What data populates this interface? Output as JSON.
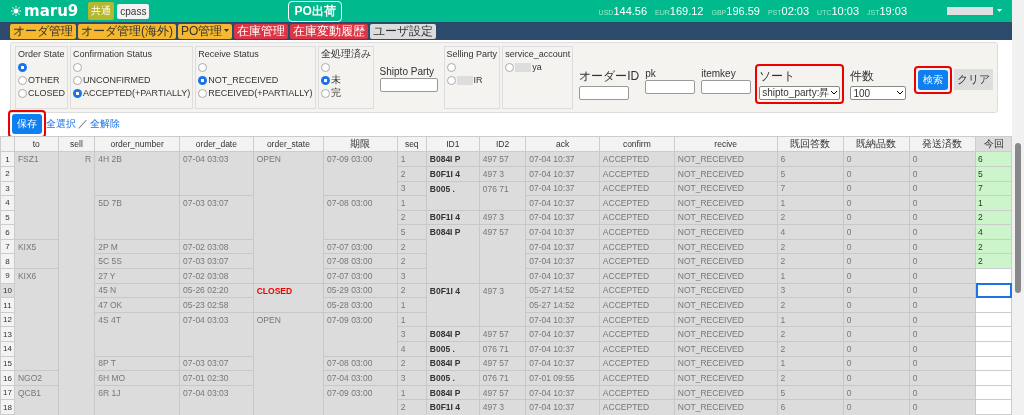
{
  "header": {
    "logo": "maru9",
    "badges": [
      {
        "label": "共通",
        "kind": "olive"
      },
      {
        "label": "cpass",
        "kind": "light"
      }
    ],
    "title": "PO出荷",
    "rates": [
      {
        "label": "USD",
        "value": "144.56"
      },
      {
        "label": "EUR",
        "value": "169.12"
      },
      {
        "label": "GBP",
        "value": "196.59"
      },
      {
        "label": "PST",
        "value": "02:03"
      },
      {
        "label": "UTC",
        "value": "10:03"
      },
      {
        "label": "JST",
        "value": "19:03"
      }
    ]
  },
  "nav": [
    {
      "label": "オーダ管理",
      "color": "#f5b82e",
      "dropdown": false
    },
    {
      "label": "オーダ管理(海外)",
      "color": "#f5b82e",
      "dropdown": false
    },
    {
      "label": "PO管理",
      "color": "#f5b82e",
      "dropdown": true
    },
    {
      "label": "在庫管理",
      "color": "#dc3545",
      "dropdown": false
    },
    {
      "label": "在庫変動履歴",
      "color": "#dc3545",
      "dropdown": false
    },
    {
      "label": "ユーザ設定",
      "color": "#dddddd",
      "dropdown": false
    }
  ],
  "filters": {
    "radio_groups": [
      {
        "title": "Order State",
        "options": [
          {
            "checked": true
          },
          {
            "label": "OTHER",
            "checked": false
          },
          {
            "label": "CLOSED",
            "checked": false
          }
        ]
      },
      {
        "title": "Confirmation Status",
        "options": [
          {
            "checked": false
          },
          {
            "label": "UNCONFIRMED",
            "checked": false
          },
          {
            "label": "ACCEPTED(+PARTIALLY)",
            "checked": true
          }
        ]
      },
      {
        "title": "Receive Status",
        "options": [
          {
            "checked": false
          },
          {
            "label": "NOT_RECEIVED",
            "checked": true
          },
          {
            "label": "RECEIVED(+PARTIALLY)",
            "checked": false
          }
        ]
      },
      {
        "title": "全処理済み",
        "options": [
          {
            "checked": false
          },
          {
            "label": "未",
            "checked": true
          },
          {
            "label": "完",
            "checked": false
          }
        ]
      }
    ],
    "shipto_party": {
      "label": "Shipto Party"
    },
    "selling_party": {
      "title": "Selling Party",
      "options": [
        {
          "checked": false
        },
        {
          "label": "IR",
          "masked": true,
          "checked": false
        }
      ]
    },
    "service_account": {
      "title": "service_account",
      "options": [
        {
          "label": "ya",
          "masked": true,
          "checked": false
        }
      ]
    },
    "text_fields": [
      {
        "label": "オーダーID"
      },
      {
        "label": "pk"
      },
      {
        "label": "itemkey"
      }
    ],
    "selects": [
      {
        "label": "ソート",
        "value": "shipto_party:昇",
        "highlighted": true
      },
      {
        "label": "件数",
        "value": "100",
        "highlighted": false
      }
    ],
    "search_button": {
      "label": "検索",
      "highlighted": true
    },
    "clear_button": {
      "label": "クリア"
    }
  },
  "actions": {
    "save": {
      "label": "保存",
      "highlighted": true
    },
    "select_all": "全選択",
    "separator": "／",
    "deselect_all": "全解除"
  },
  "table": {
    "columns": [
      "to",
      "sell",
      "order_number",
      "order_date",
      "order_state",
      "期限",
      "seq",
      "ID1",
      "ID2",
      "ack",
      "confirm",
      "recive",
      "既回答数",
      "既納品数",
      "発送済数",
      "今回"
    ],
    "rows": [
      {
        "no": "1",
        "selected": false,
        "to": "FSZ1",
        "sell": "R",
        "order_number": "4H 2B",
        "order_date": "07-04 03:03",
        "order_state": "OPEN",
        "emphasized": false,
        "limit": "07-09 03:00",
        "seq": "1",
        "id1": "B084I P",
        "id2": "497 57",
        "ack": "07-04 10:37",
        "confirm": "ACCEPTED",
        "recive": "NOT_RECEIVED",
        "answered": "6",
        "delivered": "0",
        "shipped": "0",
        "current": "6"
      },
      {
        "no": "2",
        "selected": false,
        "seq": "2",
        "id1": "B0F1I 4",
        "id2": "497 3",
        "ack": "07-04 10:37",
        "confirm": "ACCEPTED",
        "recive": "NOT_RECEIVED",
        "answered": "5",
        "delivered": "0",
        "shipped": "0",
        "current": "5"
      },
      {
        "no": "3",
        "selected": false,
        "seq": "3",
        "id1": "B005 .",
        "id2": "076 71",
        "ack": "07-04 10:37",
        "confirm": "ACCEPTED",
        "recive": "NOT_RECEIVED",
        "answered": "7",
        "delivered": "0",
        "shipped": "0",
        "current": "7"
      },
      {
        "no": "4",
        "selected": false,
        "order_number": "5D 7B",
        "order_date": "07-03 03:07",
        "limit": "07-08 03:00",
        "seq": "1",
        "ack": "07-04 10:37",
        "confirm": "ACCEPTED",
        "recive": "NOT_RECEIVED",
        "answered": "1",
        "delivered": "0",
        "shipped": "0",
        "current": "1"
      },
      {
        "no": "5",
        "selected": false,
        "seq": "2",
        "id1": "B0F1I 4",
        "id2": "497 3",
        "ack": "07-04 10:37",
        "confirm": "ACCEPTED",
        "recive": "NOT_RECEIVED",
        "answered": "2",
        "delivered": "0",
        "shipped": "0",
        "current": "2"
      },
      {
        "no": "6",
        "selected": false,
        "seq": "5",
        "id1": "B084I P",
        "id2": "497 57",
        "ack": "07-04 10:37",
        "confirm": "ACCEPTED",
        "recive": "NOT_RECEIVED",
        "answered": "4",
        "delivered": "0",
        "shipped": "0",
        "current": "4"
      },
      {
        "no": "7",
        "selected": false,
        "to": "KIX5",
        "order_number": "2P M",
        "order_date": "07-02 03:08",
        "limit": "07-07 03:00",
        "seq": "2",
        "ack": "07-04 10:37",
        "confirm": "ACCEPTED",
        "recive": "NOT_RECEIVED",
        "answered": "2",
        "delivered": "0",
        "shipped": "0",
        "current": "2"
      },
      {
        "no": "8",
        "selected": false,
        "order_number": "5C 5S",
        "order_date": "07-03 03:07",
        "limit": "07-08 03:00",
        "seq": "2",
        "ack": "07-04 10:37",
        "confirm": "ACCEPTED",
        "recive": "NOT_RECEIVED",
        "answered": "2",
        "delivered": "0",
        "shipped": "0",
        "current": "2"
      },
      {
        "no": "9",
        "selected": false,
        "to": "KIX6",
        "order_number": "27 Y",
        "order_date": "07-02 03:08",
        "limit": "07-07 03:00",
        "seq": "3",
        "ack": "07-04 10:37",
        "confirm": "ACCEPTED",
        "recive": "NOT_RECEIVED",
        "answered": "1",
        "delivered": "0",
        "shipped": "0"
      },
      {
        "no": "10",
        "selected": true,
        "order_number": "45 N",
        "order_date": "05-26 02:20",
        "order_state": "CLOSED",
        "emphasized": true,
        "limit": "05-29 03:00",
        "seq": "2",
        "id1": "B0F1I 4",
        "id2": "497 3",
        "ack": "05-27 14:52",
        "confirm": "ACCEPTED",
        "recive": "NOT_RECEIVED",
        "answered": "3",
        "delivered": "0",
        "shipped": "0"
      },
      {
        "no": "11",
        "selected": false,
        "order_number": "47 OK",
        "order_date": "05-23 02:58",
        "limit": "05-28 03:00",
        "seq": "1",
        "ack": "05-27 14:52",
        "confirm": "ACCEPTED",
        "recive": "NOT_RECEIVED",
        "answered": "2",
        "delivered": "0",
        "shipped": "0"
      },
      {
        "no": "12",
        "selected": false,
        "order_number": "4S 4T",
        "order_date": "07-04 03:03",
        "order_state": "OPEN",
        "emphasized": false,
        "limit": "07-09 03:00",
        "seq": "1",
        "ack": "07-04 10:37",
        "confirm": "ACCEPTED",
        "recive": "NOT_RECEIVED",
        "answered": "1",
        "delivered": "0",
        "shipped": "0"
      },
      {
        "no": "13",
        "selected": false,
        "seq": "3",
        "id1": "B084I P",
        "id2": "497 57",
        "ack": "07-04 10:37",
        "confirm": "ACCEPTED",
        "recive": "NOT_RECEIVED",
        "answered": "2",
        "delivered": "0",
        "shipped": "0"
      },
      {
        "no": "14",
        "selected": false,
        "seq": "4",
        "id1": "B005 .",
        "id2": "076 71",
        "ack": "07-04 10:37",
        "confirm": "ACCEPTED",
        "recive": "NOT_RECEIVED",
        "answered": "2",
        "delivered": "0",
        "shipped": "0"
      },
      {
        "no": "15",
        "selected": false,
        "order_number": "8P T",
        "order_date": "07-03 03:07",
        "limit": "07-08 03:00",
        "seq": "2",
        "id1": "B084I P",
        "id2": "497 57",
        "ack": "07-04 10:37",
        "confirm": "ACCEPTED",
        "recive": "NOT_RECEIVED",
        "answered": "1",
        "delivered": "0",
        "shipped": "0"
      },
      {
        "no": "16",
        "selected": false,
        "to": "NGO2",
        "order_number": "6H MO",
        "order_date": "07-01 02:30",
        "limit": "07-04 03:00",
        "seq": "3",
        "id1": "B005 .",
        "id2": "076 71",
        "ack": "07-01 09:55",
        "confirm": "ACCEPTED",
        "recive": "NOT_RECEIVED",
        "answered": "2",
        "delivered": "0",
        "shipped": "0"
      },
      {
        "no": "17",
        "selected": false,
        "to": "QCB1",
        "order_number": "6R 1J",
        "order_date": "07-04 03:03",
        "limit": "07-09 03:00",
        "seq": "1",
        "id1": "B084I P",
        "id2": "497 57",
        "ack": "07-04 10:37",
        "confirm": "ACCEPTED",
        "recive": "NOT_RECEIVED",
        "answered": "5",
        "delivered": "0",
        "shipped": "0"
      },
      {
        "no": "18",
        "selected": false,
        "seq": "2",
        "id1": "B0F1I 4",
        "id2": "497 3",
        "ack": "07-04 10:37",
        "confirm": "ACCEPTED",
        "recive": "NOT_RECEIVED",
        "answered": "6",
        "delivered": "0",
        "shipped": "0"
      }
    ]
  }
}
